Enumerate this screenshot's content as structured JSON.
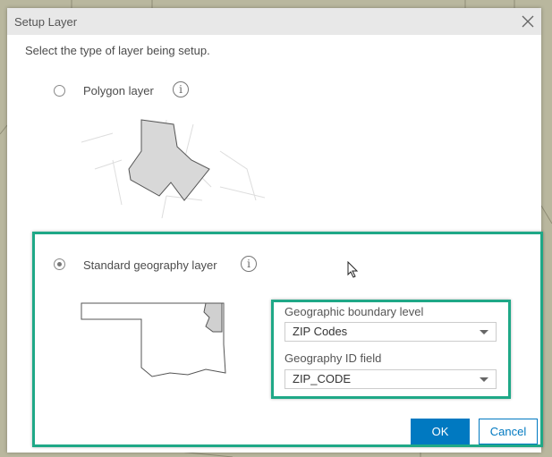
{
  "dialog": {
    "title": "Setup Layer",
    "intro": "Select the type of layer being setup."
  },
  "options": [
    {
      "label": "Polygon layer",
      "selected": false
    },
    {
      "label": "Standard geography layer",
      "selected": true
    }
  ],
  "fields": {
    "boundary_label": "Geographic boundary level",
    "boundary_value": "ZIP Codes",
    "id_label": "Geography ID field",
    "id_value": "ZIP_CODE"
  },
  "buttons": {
    "ok": "OK",
    "cancel": "Cancel"
  },
  "colors": {
    "highlight": "#1fa887",
    "primary": "#0079c1"
  }
}
